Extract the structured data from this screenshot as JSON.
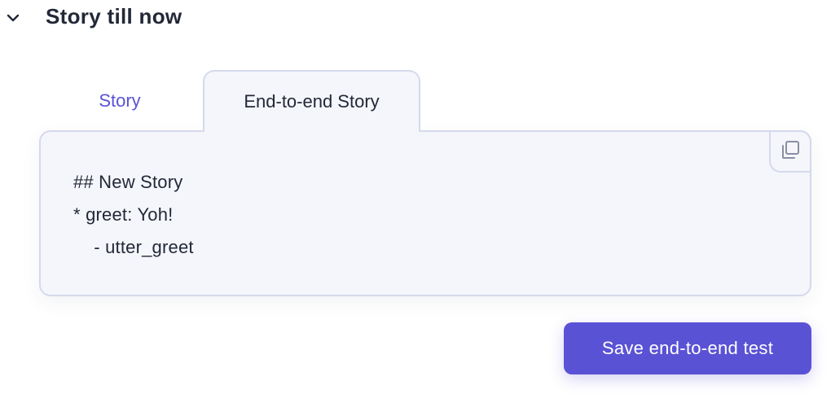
{
  "section": {
    "title": "Story till now",
    "expanded_icon": "chevron-down-icon"
  },
  "tabs": [
    {
      "label": "Story",
      "active": false
    },
    {
      "label": "End-to-end Story",
      "active": true
    }
  ],
  "code_panel": {
    "copy_icon": "copy-icon",
    "lines": [
      "## New Story",
      "* greet: Yoh!",
      "    - utter_greet"
    ]
  },
  "actions": {
    "save_label": "Save end-to-end test"
  },
  "colors": {
    "accent": "#5a52d5",
    "panel_bg": "#f4f6fb",
    "panel_border": "#d6d9ec",
    "text": "#232838"
  }
}
